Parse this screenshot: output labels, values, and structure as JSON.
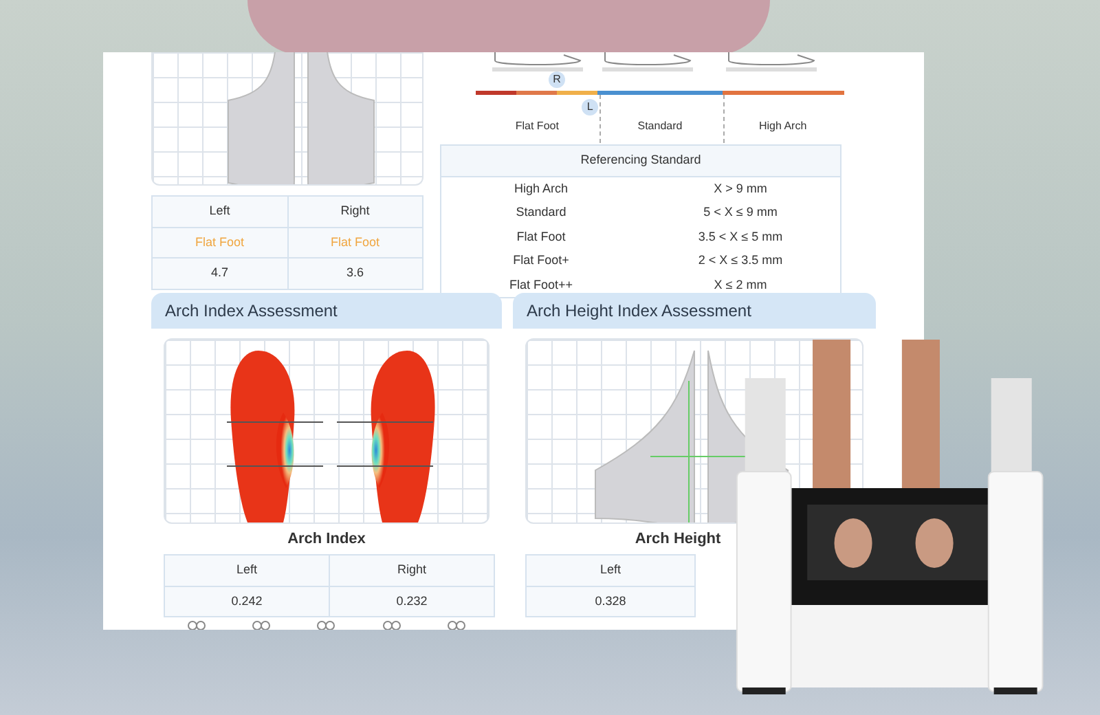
{
  "report": {
    "heel_table": {
      "columns": [
        "Left",
        "Right"
      ],
      "rows": [
        {
          "kind": "status",
          "cells": [
            "Flat Foot",
            "Flat Foot"
          ]
        },
        {
          "kind": "value",
          "cells": [
            "4.7",
            "3.6"
          ]
        }
      ]
    },
    "scale": {
      "markers": [
        {
          "label": "R",
          "kind": "upper",
          "level": 0.22
        },
        {
          "label": "L",
          "kind": "lower",
          "level": 0.31
        }
      ],
      "labels": [
        "Flat Foot",
        "Standard",
        "High Arch"
      ]
    },
    "reference_table": {
      "title": "Referencing Standard",
      "rows": [
        [
          "High Arch",
          "X > 9 mm"
        ],
        [
          "Standard",
          "5 < X ≤ 9 mm"
        ],
        [
          "Flat Foot",
          "3.5 < X ≤ 5 mm"
        ],
        [
          "Flat Foot+",
          "2 < X ≤ 3.5 mm"
        ],
        [
          "Flat Foot++",
          "X ≤ 2 mm"
        ]
      ]
    },
    "sections": [
      {
        "kind": "heatmap",
        "title": "Arch Index Assessment",
        "subtitle": "Arch Index",
        "table": {
          "columns": [
            "Left",
            "Right"
          ],
          "rows": [
            [
              "0.242",
              "0.232"
            ]
          ]
        }
      },
      {
        "kind": "profile",
        "title": "Arch Height Index Assessment",
        "subtitle": "Arch Height",
        "table": {
          "columns": [
            "Left"
          ],
          "rows": [
            [
              "0.328"
            ]
          ]
        }
      }
    ]
  }
}
